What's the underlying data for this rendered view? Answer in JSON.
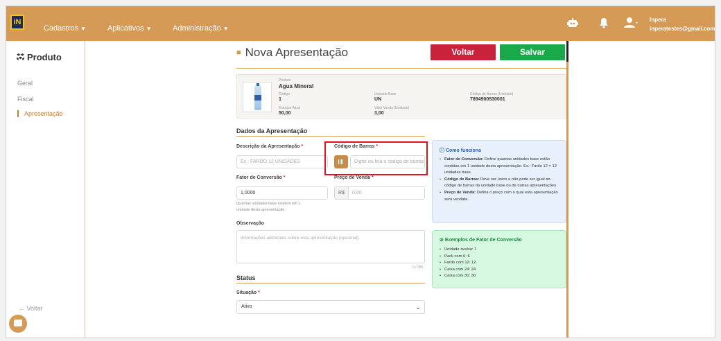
{
  "topbar": {
    "logo_text": "iN",
    "nav": [
      {
        "label": "Cadastros"
      },
      {
        "label": "Aplicativos"
      },
      {
        "label": "Administração"
      }
    ],
    "user_name": "Inpera",
    "user_email": "inperatestes@gmail.com"
  },
  "sidebar": {
    "title": "Produto",
    "items": [
      {
        "label": "Geral"
      },
      {
        "label": "Fiscal"
      },
      {
        "label": "Apresentação"
      }
    ],
    "back_label": "← Voltar"
  },
  "header": {
    "title": "Nova Apresentação",
    "voltar_label": "Voltar",
    "salvar_label": "Salvar"
  },
  "product": {
    "produto_label": "Produto",
    "produto_value": "Agua Mineral",
    "codigo_label": "Código",
    "codigo_value": "1",
    "unidade_label": "Unidade Base",
    "unidade_value": "UN",
    "barras_label": "Código de Barras (Unidade)",
    "barras_value": "7894900530001",
    "estoque_label": "Estoque Atual",
    "estoque_value": "50,00",
    "valor_label": "Valor Venda (Unidade)",
    "valor_value": "3,00"
  },
  "form": {
    "section_title": "Dados da Apresentação",
    "descricao_label": "Descrição da Apresentação",
    "descricao_placeholder": "Ex.: FARDO 12 UNIDADES",
    "barras_label": "Código de Barras",
    "barras_placeholder": "Digite ou leia o código de barras",
    "fator_label": "Fator de Conversão",
    "fator_value": "1,0000",
    "fator_hint_line1": "Quantas unidades base existem em 1",
    "fator_hint_line2": "unidade desta apresentação.",
    "preco_label": "Preço de Venda",
    "preco_prefix": "R$",
    "preco_placeholder": "0,00",
    "obs_label": "Observação",
    "obs_placeholder": "Informações adicionais sobre esta apresentação (opcional)",
    "obs_counter": "0 / 255",
    "required_mark": "*"
  },
  "status": {
    "section_title": "Status",
    "situacao_label": "Situação",
    "situacao_value": "Ativo"
  },
  "info": {
    "title": "Como funciona",
    "items": [
      {
        "key": "Fator de Conversão:",
        "text": " Define quantas unidades base estão contidas em 1 unidade desta apresentação. Ex.: Fardo 12 = 12 unidades base."
      },
      {
        "key": "Código de Barras:",
        "text": " Deve ser único e não pode ser igual ao código de barras da unidade base ou de outras apresentações."
      },
      {
        "key": "Preço de Venda:",
        "text": " Defina o preço com o qual esta apresentação será vendida."
      }
    ]
  },
  "examples": {
    "title": "Exemplos de Fator de Conversão",
    "items": [
      "Unidade avulsa: 1",
      "Pack com 6: 6",
      "Fardo com 12: 12",
      "Caixa com 24: 24",
      "Caixa com 30: 30"
    ]
  },
  "colors": {
    "brand": "#d59a55",
    "danger": "#c8233b",
    "success": "#19a84a",
    "info_bg": "#e8f0fb",
    "example_bg": "#d6f7e0"
  }
}
